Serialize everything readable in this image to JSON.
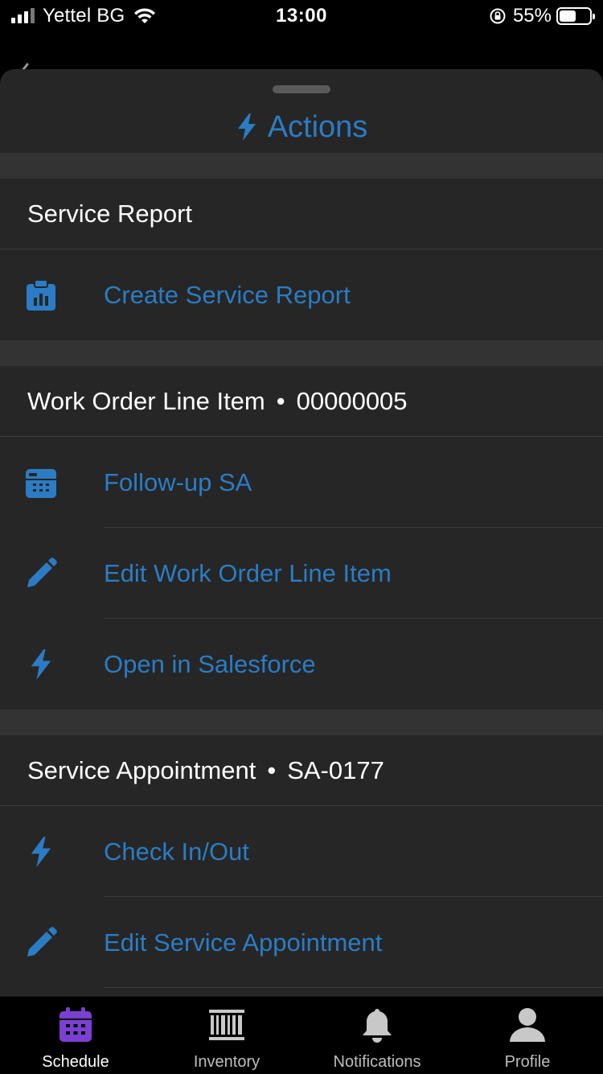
{
  "status": {
    "carrier": "Yettel BG",
    "time": "13:00",
    "battery": "55%",
    "battery_level": 0.55
  },
  "sheet": {
    "title": "Actions"
  },
  "sections": [
    {
      "title": "Service Report",
      "record": "",
      "actions": [
        {
          "label": "Create Service Report",
          "icon": "clipboard-chart-icon"
        }
      ]
    },
    {
      "title": "Work Order Line Item",
      "record": "00000005",
      "actions": [
        {
          "label": "Follow-up SA",
          "icon": "calendar-icon"
        },
        {
          "label": "Edit Work Order Line Item",
          "icon": "pencil-icon"
        },
        {
          "label": "Open in Salesforce",
          "icon": "lightning-icon"
        }
      ]
    },
    {
      "title": "Service Appointment",
      "record": "SA-0177",
      "actions": [
        {
          "label": "Check In/Out",
          "icon": "lightning-icon"
        },
        {
          "label": "Edit Service Appointment",
          "icon": "pencil-icon"
        }
      ]
    }
  ],
  "separator": "•",
  "tabs": [
    {
      "label": "Schedule",
      "icon": "calendar-icon",
      "active": true
    },
    {
      "label": "Inventory",
      "icon": "barcode-icon",
      "active": false
    },
    {
      "label": "Notifications",
      "icon": "bell-icon",
      "active": false
    },
    {
      "label": "Profile",
      "icon": "person-icon",
      "active": false
    }
  ],
  "colors": {
    "accent": "#2b7cc4",
    "active_tab": "#7b3fd1",
    "sheet_bg": "#262626",
    "gap_bg": "#333333"
  }
}
